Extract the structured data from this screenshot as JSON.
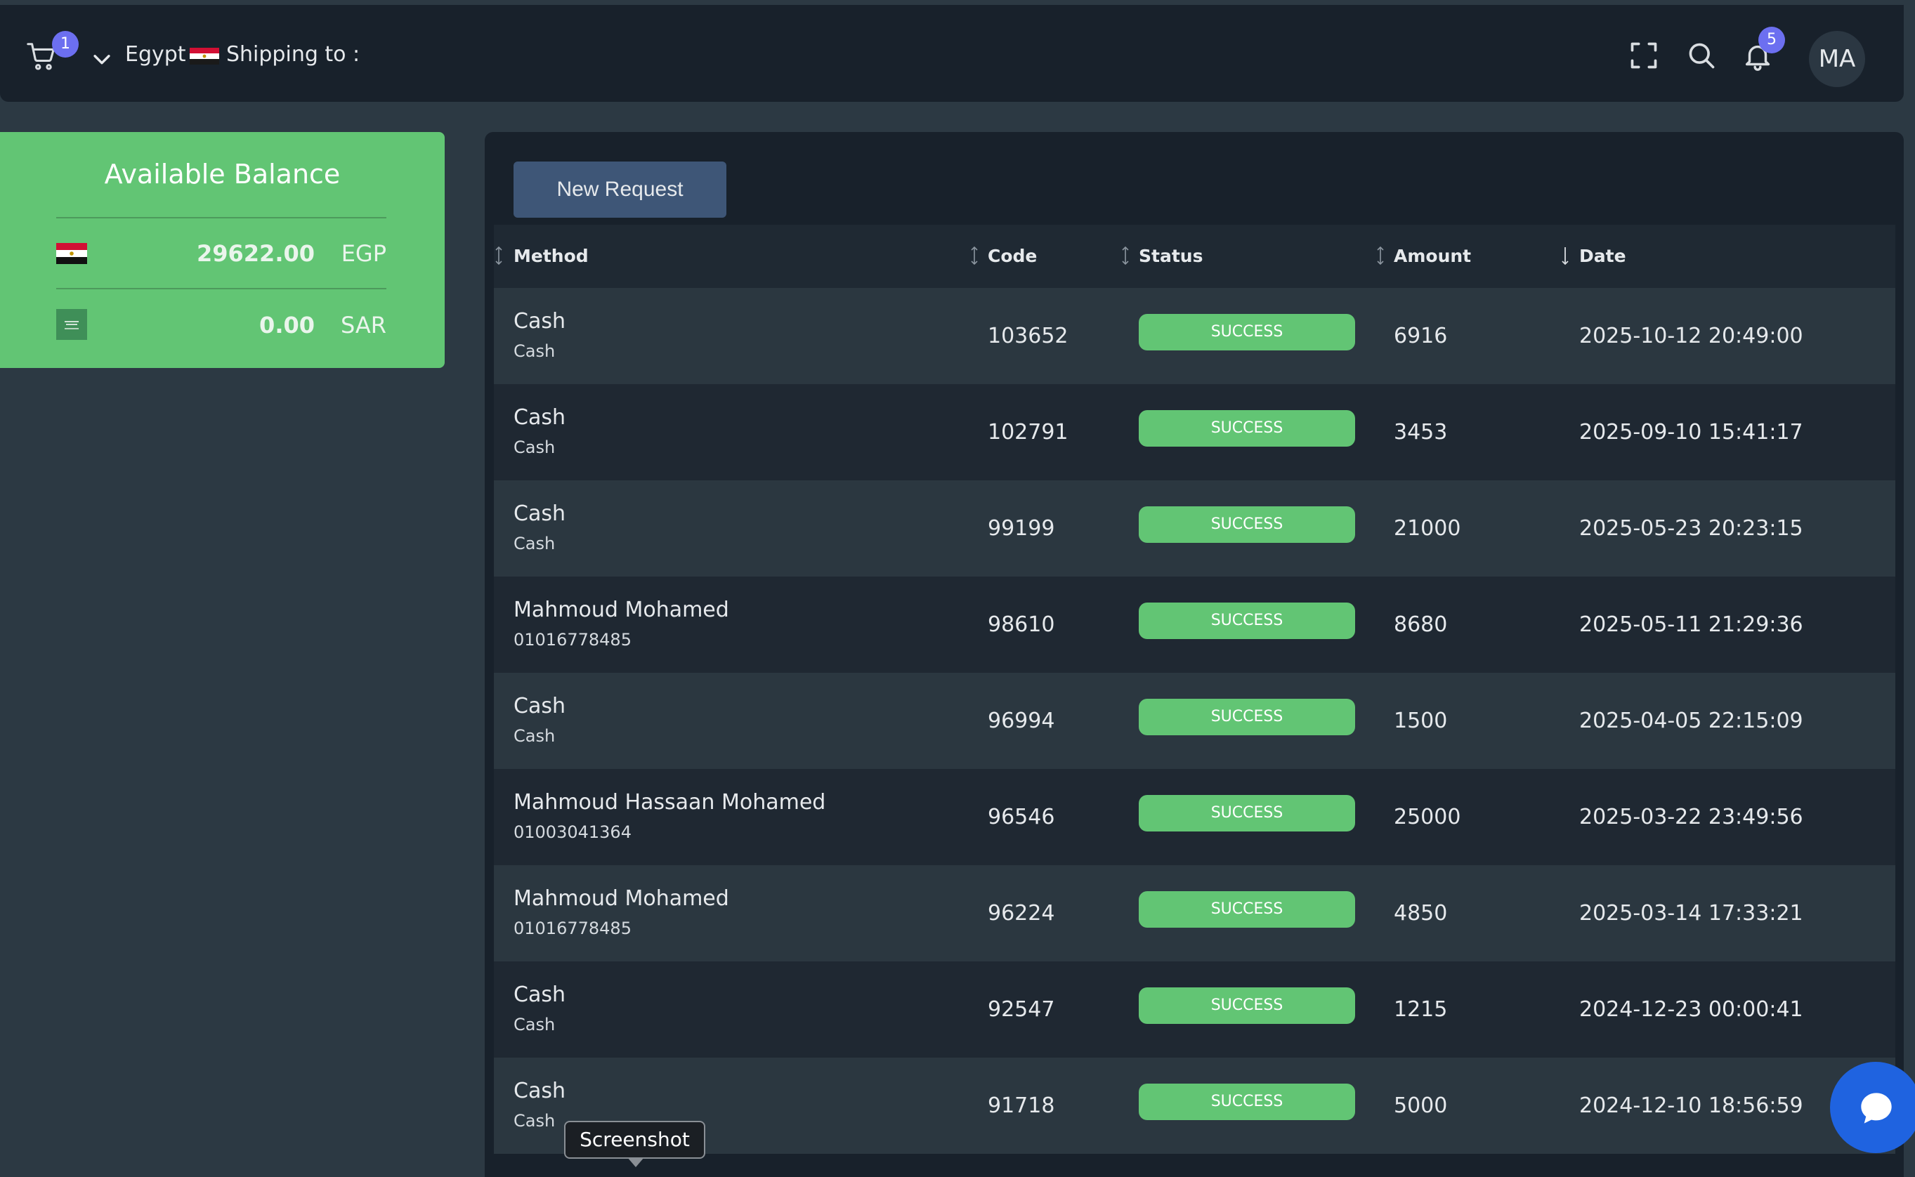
{
  "topbar": {
    "cart_badge": "1",
    "country": "Egypt",
    "shipping_label": "Shipping to :",
    "notifications_badge": "5",
    "avatar_initials": "MA"
  },
  "balance": {
    "title": "Available Balance",
    "rows": [
      {
        "amount": "29622.00",
        "currency": "EGP",
        "flag": "egypt-flag-icon"
      },
      {
        "amount": "0.00",
        "currency": "SAR",
        "flag": "saudi-flag-icon"
      }
    ]
  },
  "actions": {
    "new_request_label": "New Request"
  },
  "table": {
    "columns": [
      "Method",
      "Code",
      "Status",
      "Amount",
      "Date"
    ],
    "rows": [
      {
        "method": "Cash",
        "method_sub": "Cash",
        "code": "103652",
        "status": "SUCCESS",
        "amount": "6916",
        "date": "2025-10-12 20:49:00"
      },
      {
        "method": "Cash",
        "method_sub": "Cash",
        "code": "102791",
        "status": "SUCCESS",
        "amount": "3453",
        "date": "2025-09-10 15:41:17"
      },
      {
        "method": "Cash",
        "method_sub": "Cash",
        "code": "99199",
        "status": "SUCCESS",
        "amount": "21000",
        "date": "2025-05-23 20:23:15"
      },
      {
        "method": "Mahmoud Mohamed",
        "method_sub": "01016778485",
        "code": "98610",
        "status": "SUCCESS",
        "amount": "8680",
        "date": "2025-05-11 21:29:36"
      },
      {
        "method": "Cash",
        "method_sub": "Cash",
        "code": "96994",
        "status": "SUCCESS",
        "amount": "1500",
        "date": "2025-04-05 22:15:09"
      },
      {
        "method": "Mahmoud Hassaan Mohamed",
        "method_sub": "01003041364",
        "code": "96546",
        "status": "SUCCESS",
        "amount": "25000",
        "date": "2025-03-22 23:49:56"
      },
      {
        "method": "Mahmoud Mohamed",
        "method_sub": "01016778485",
        "code": "96224",
        "status": "SUCCESS",
        "amount": "4850",
        "date": "2025-03-14 17:33:21"
      },
      {
        "method": "Cash",
        "method_sub": "Cash",
        "code": "92547",
        "status": "SUCCESS",
        "amount": "1215",
        "date": "2024-12-23 00:00:41"
      },
      {
        "method": "Cash",
        "method_sub": "Cash",
        "code": "91718",
        "status": "SUCCESS",
        "amount": "5000",
        "date": "2024-12-10 18:56:59"
      }
    ]
  },
  "tooltip": {
    "text": "Screenshot"
  },
  "colors": {
    "success": "#62c574",
    "accent_badge": "#6c6ff0",
    "button": "#3e5677",
    "chat_fab": "#1f63e0"
  }
}
